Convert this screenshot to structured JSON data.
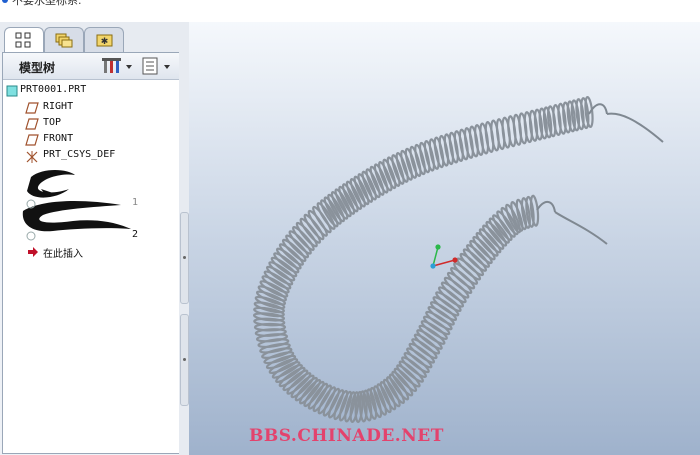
{
  "message_bar": {
    "text": "不要水型标系."
  },
  "nav_tabs": [
    {
      "icon": "model-tree-icon",
      "active": true
    },
    {
      "icon": "folder-browser-icon",
      "active": false
    },
    {
      "icon": "favorites-icon",
      "active": false
    }
  ],
  "model_tree": {
    "title": "模型树",
    "items": [
      {
        "label": "PRT0001.PRT",
        "icon": "part-icon"
      },
      {
        "label": "RIGHT",
        "icon": "datum-plane-icon"
      },
      {
        "label": "TOP",
        "icon": "datum-plane-icon"
      },
      {
        "label": "FRONT",
        "icon": "datum-plane-icon"
      },
      {
        "label": "PRT_CSYS_DEF",
        "icon": "coordinate-system-icon"
      },
      {
        "label": "1",
        "icon": "feature-icon"
      },
      {
        "label": "2",
        "icon": "feature-icon"
      },
      {
        "label": "在此插入",
        "icon": "insert-here-icon"
      }
    ]
  },
  "watermark": "BBS.CHINADE.NET",
  "colors": {
    "accent": "#1f5fd0",
    "watermark": "#e3436d",
    "spring": "#8a929b"
  }
}
